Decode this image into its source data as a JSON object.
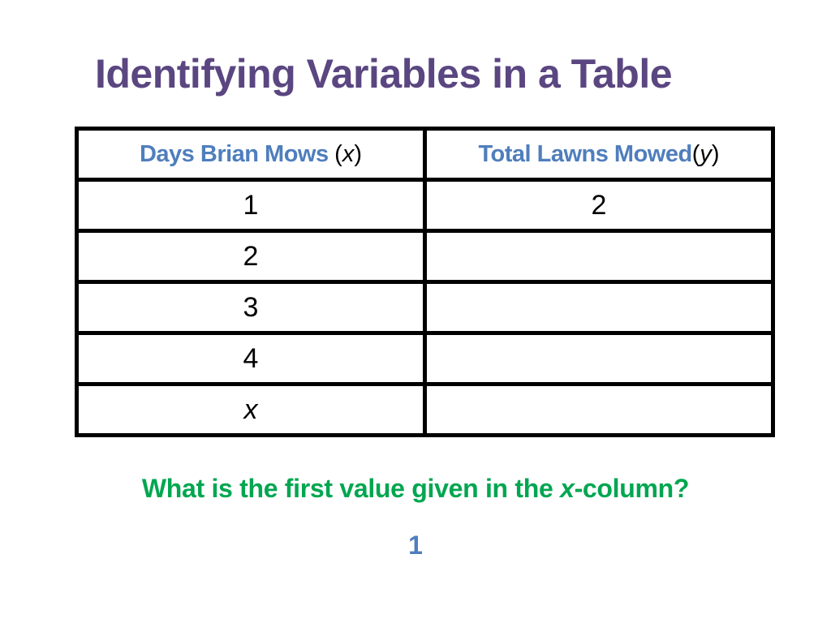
{
  "slide": {
    "title": "Identifying Variables in a Table",
    "table": {
      "headers": [
        {
          "label": "Days Brian Mows ",
          "open": "(",
          "variable": "x",
          "close": ")"
        },
        {
          "label": "Total Lawns Mowed",
          "open": "(",
          "variable": "y",
          "close": ")"
        }
      ],
      "rows": [
        {
          "x": "1",
          "y": "2"
        },
        {
          "x": "2",
          "y": ""
        },
        {
          "x": "3",
          "y": ""
        },
        {
          "x": "4",
          "y": ""
        },
        {
          "x": "x",
          "y": ""
        }
      ]
    },
    "question": {
      "prefix": "What is the first value given in the ",
      "variable": "x",
      "suffix": "-column?"
    },
    "answer": "1",
    "colors": {
      "title": "#5a4680",
      "header": "#4f7ebd",
      "question": "#00a650",
      "answer": "#4f7ebd"
    }
  }
}
